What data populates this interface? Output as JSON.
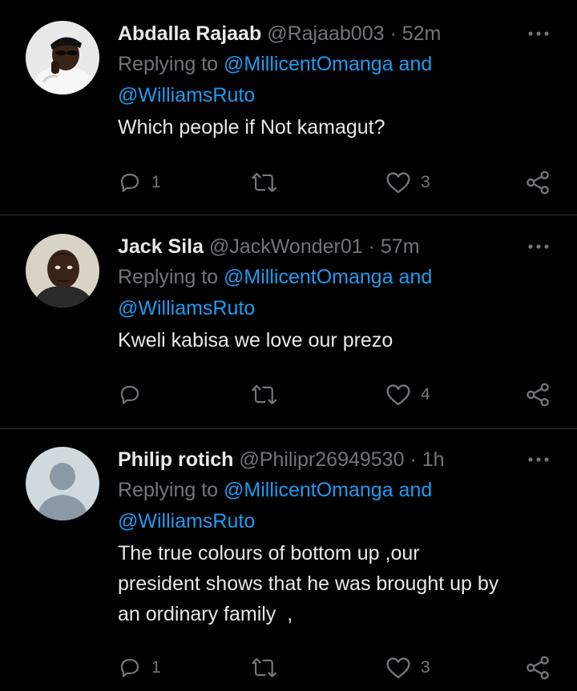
{
  "theme": {
    "background": "#000000",
    "text": "#e7e9ea",
    "muted": "#71767b",
    "link": "#1d9bf0",
    "divider": "#2f3336"
  },
  "tweets": [
    {
      "display_name": "Abdalla Rajaab",
      "handle": "@Rajaab003",
      "separator": "·",
      "time": "52m",
      "replying_prefix": "Replying to",
      "mention_1": "@MillicentOmanga",
      "and": "and",
      "mention_2": "@WilliamsRuto",
      "text_lines": [
        "Which people if Not kamagut?"
      ],
      "replies": "1",
      "retweets": "",
      "likes": "3",
      "avatar_icon": "user-photo-avatar"
    },
    {
      "display_name": "Jack Sila",
      "handle": "@JackWonder01",
      "separator": "·",
      "time": "57m",
      "replying_prefix": "Replying to",
      "mention_1": "@MillicentOmanga",
      "and": "and",
      "mention_2": "@WilliamsRuto",
      "text_lines": [
        "Kweli kabisa we love our prezo"
      ],
      "replies": "",
      "retweets": "",
      "likes": "4",
      "avatar_icon": "user-photo-avatar"
    },
    {
      "display_name": "Philip rotich",
      "handle": "@Philipr26949530",
      "separator": "·",
      "time": "1h",
      "replying_prefix": "Replying to",
      "mention_1": "@MillicentOmanga",
      "and": "and",
      "mention_2": "@WilliamsRuto",
      "text_lines": [
        "The true colours of bottom up ,our",
        "president shows that he was brought up by",
        "an ordinary family  ,"
      ],
      "replies": "1",
      "retweets": "",
      "likes": "3",
      "avatar_icon": "default-profile-avatar"
    }
  ],
  "icons": {
    "reply": "reply-icon",
    "retweet": "retweet-icon",
    "like": "heart-icon",
    "share": "share-icon",
    "more": "more-options-icon"
  }
}
